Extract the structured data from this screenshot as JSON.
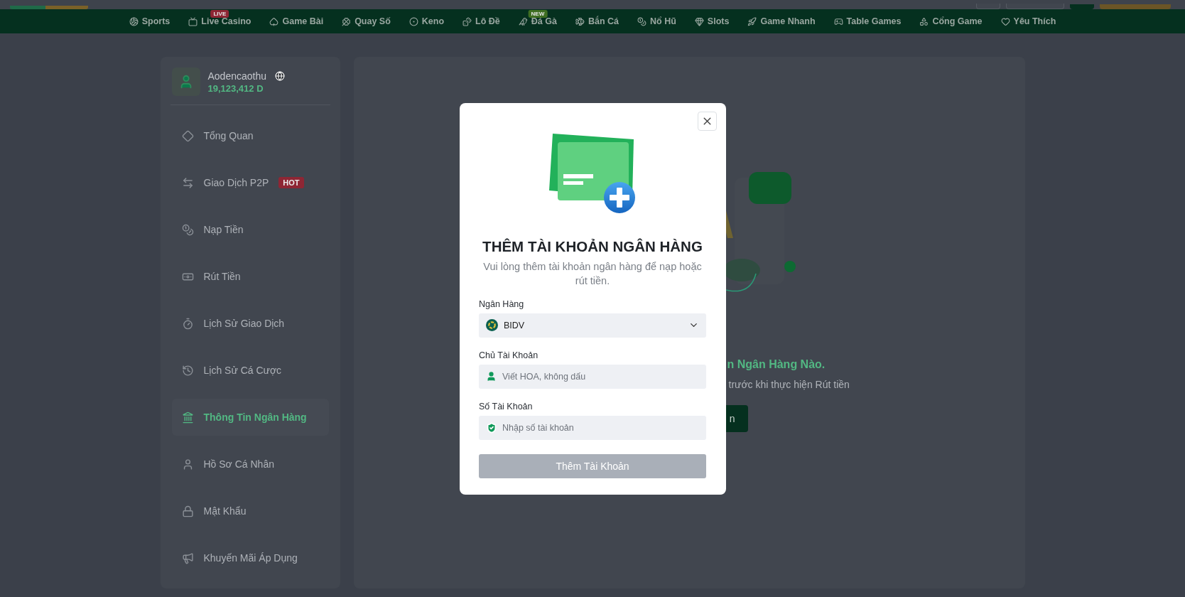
{
  "top_nav": [
    {
      "label": "Sports"
    },
    {
      "label": "Live Casino",
      "badge": {
        "text": "LIVE",
        "color": "#8e2634"
      }
    },
    {
      "label": "Game Bài"
    },
    {
      "label": "Quay Số"
    },
    {
      "label": "Keno"
    },
    {
      "label": "Lô Đề"
    },
    {
      "label": "Đá Gà",
      "badge": {
        "text": "NEW",
        "color": "#3f6e22"
      }
    },
    {
      "label": "Bắn Cá"
    },
    {
      "label": "Nổ Hũ"
    },
    {
      "label": "Slots"
    },
    {
      "label": "Game Nhanh"
    },
    {
      "label": "Table Games"
    },
    {
      "label": "Cổng Game"
    },
    {
      "label": "Yêu Thích"
    }
  ],
  "profile": {
    "username": "Aodencaothu",
    "balance": "19,123,412 D"
  },
  "sidebar": {
    "items": [
      {
        "label": "Tổng Quan",
        "selected": false
      },
      {
        "label": "Giao Dịch P2P",
        "selected": false,
        "badge": "HOT"
      },
      {
        "label": "Nạp Tiền",
        "selected": false
      },
      {
        "label": "Rút Tiền",
        "selected": false
      },
      {
        "label": "Lịch Sử Giao Dịch",
        "selected": false
      },
      {
        "label": "Lịch Sử Cá Cược",
        "selected": false
      },
      {
        "label": "Thông Tin Ngân Hàng",
        "selected": true
      },
      {
        "label": "Hồ Sơ Cá Nhân",
        "selected": false
      },
      {
        "label": "Mật Khẩu",
        "selected": false
      },
      {
        "label": "Khuyến Mãi Áp Dụng",
        "selected": false
      }
    ]
  },
  "main": {
    "title_fragment": "n Ngân Hàng Nào.",
    "subtitle_fragment": "trước khi thực hiện Rút tiền",
    "button_fragment": "n"
  },
  "modal": {
    "title": "THÊM TÀI KHOẢN NGÂN HÀNG",
    "subtitle": "Vui lòng thêm tài khoản ngân hàng để nạp hoặc rút tiền.",
    "fields": [
      {
        "kind": "select",
        "label": "Ngân Hàng",
        "value": "BIDV"
      },
      {
        "kind": "text",
        "label": "Chủ Tài Khoản",
        "placeholder": "Viết HOA, không dấu"
      },
      {
        "kind": "text",
        "label": "Số Tài Khoản",
        "placeholder": "Nhập số tài khoản"
      }
    ],
    "submit": {
      "label": "Thêm Tài Khoản",
      "disabled": true
    }
  }
}
